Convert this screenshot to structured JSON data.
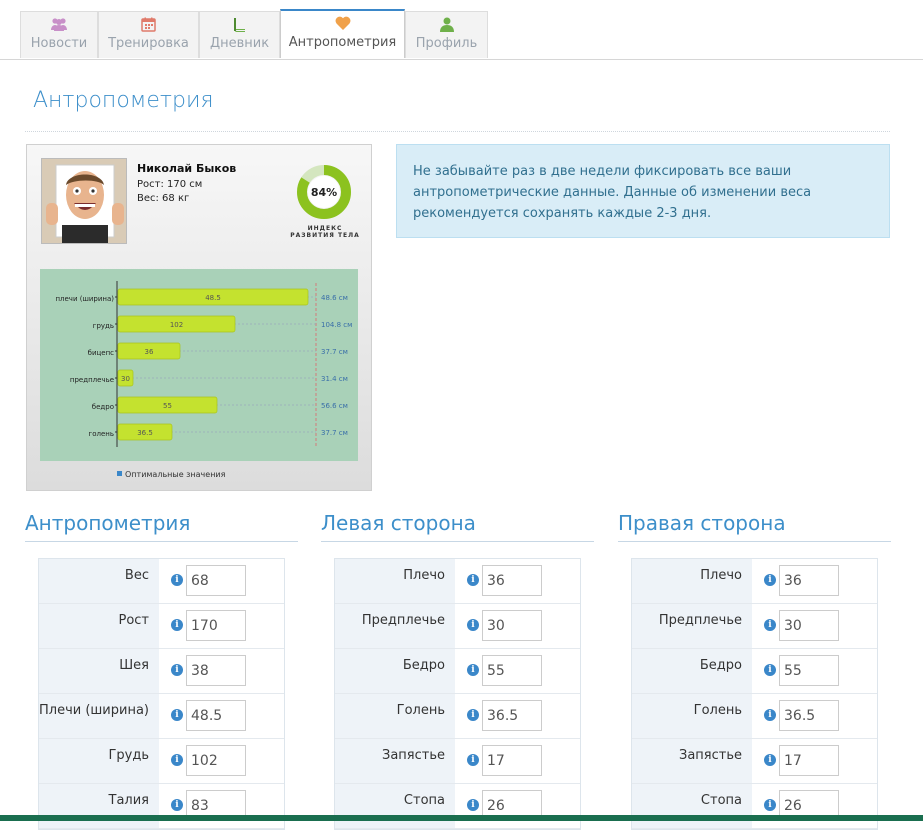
{
  "tabs": [
    {
      "label": "Новости",
      "icon": "users-icon"
    },
    {
      "label": "Тренировка",
      "icon": "calendar-icon"
    },
    {
      "label": "Дневник",
      "icon": "book-icon"
    },
    {
      "label": "Антропометрия",
      "icon": "heart-icon",
      "active": true
    },
    {
      "label": "Профиль",
      "icon": "user-icon"
    }
  ],
  "page_title": "Антропометрия",
  "card": {
    "name": "Николай Быков",
    "height": "Рост: 170 см",
    "weight": "Вес: 68 кг",
    "index_percent": "84%",
    "index_value": 84,
    "index_caption_1": "ИНДЕКС",
    "index_caption_2": "РАЗВИТИЯ ТЕЛА",
    "legend": "Оптимальные значения"
  },
  "chart_data": {
    "type": "bar",
    "categories": [
      "плечи (ширина)",
      "грудь",
      "бицепс",
      "предплечье",
      "бедро",
      "голень"
    ],
    "values": [
      48.5,
      102,
      36,
      30,
      55,
      36.5
    ],
    "value_labels": [
      "48.5",
      "102",
      "36",
      "30",
      "55",
      "36.5"
    ],
    "optimal_labels": [
      "48.6 см",
      "104.8 см",
      "37.7 см",
      "31.4 см",
      "56.6 см",
      "37.7 см"
    ],
    "legend": "Оптимальные значения"
  },
  "info_text": "Не забывайте раз в две недели фиксировать все ваши антропометрические данные. Данные об изменении веса рекомендуется сохранять каждые 2-3 дня.",
  "sections": [
    {
      "title": "Антропометрия",
      "fields": [
        {
          "label": "Вес",
          "value": "68"
        },
        {
          "label": "Рост",
          "value": "170"
        },
        {
          "label": "Шея",
          "value": "38"
        },
        {
          "label": "Плечи (ширина)",
          "value": "48.5"
        },
        {
          "label": "Грудь",
          "value": "102"
        },
        {
          "label": "Талия",
          "value": "83"
        }
      ]
    },
    {
      "title": "Левая сторона",
      "fields": [
        {
          "label": "Плечо",
          "value": "36"
        },
        {
          "label": "Предплечье",
          "value": "30"
        },
        {
          "label": "Бедро",
          "value": "55"
        },
        {
          "label": "Голень",
          "value": "36.5"
        },
        {
          "label": "Запястье",
          "value": "17"
        },
        {
          "label": "Стопа",
          "value": "26"
        }
      ]
    },
    {
      "title": "Правая сторона",
      "fields": [
        {
          "label": "Плечо",
          "value": "36"
        },
        {
          "label": "Предплечье",
          "value": "30"
        },
        {
          "label": "Бедро",
          "value": "55"
        },
        {
          "label": "Голень",
          "value": "36.5"
        },
        {
          "label": "Запястье",
          "value": "17"
        },
        {
          "label": "Стопа",
          "value": "26"
        }
      ]
    }
  ],
  "colors": {
    "accent": "#3d8fca",
    "bar": "#c4e22f",
    "donut": "#8cc21f",
    "chart_bg": "#a9d1b8",
    "optimal": "#3a6fa8"
  }
}
